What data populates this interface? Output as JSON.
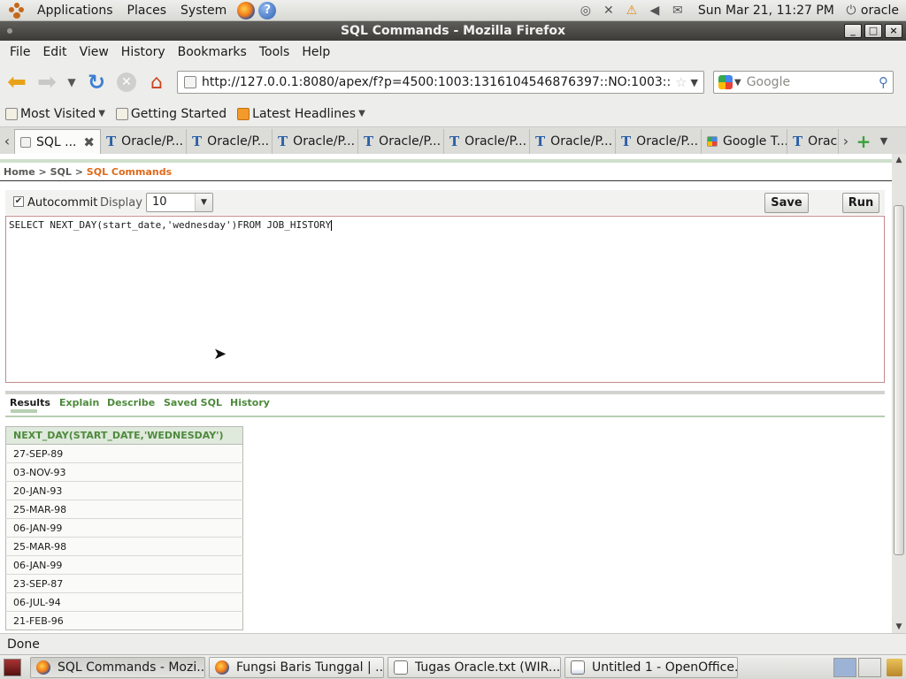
{
  "top_panel": {
    "menus": [
      "Applications",
      "Places",
      "System"
    ],
    "clock": "Sun Mar 21, 11:27 PM",
    "user": "oracle"
  },
  "window": {
    "title": "SQL Commands - Mozilla Firefox"
  },
  "menubar": [
    "File",
    "Edit",
    "View",
    "History",
    "Bookmarks",
    "Tools",
    "Help"
  ],
  "navbar": {
    "url": "http://127.0.0.1:8080/apex/f?p=4500:1003:1316104546876397::NO:1003::",
    "search_placeholder": "Google"
  },
  "bookmarks": [
    "Most Visited",
    "Getting Started",
    "Latest Headlines"
  ],
  "tabs": [
    {
      "label": "SQL ...",
      "active": true
    },
    {
      "label": "Oracle/P..."
    },
    {
      "label": "Oracle/P..."
    },
    {
      "label": "Oracle/P..."
    },
    {
      "label": "Oracle/P..."
    },
    {
      "label": "Oracle/P..."
    },
    {
      "label": "Oracle/P..."
    },
    {
      "label": "Oracle/P..."
    },
    {
      "label": "Google T..."
    },
    {
      "label": "Orac"
    }
  ],
  "page": {
    "breadcrumb": {
      "home": "Home",
      "sql": "SQL",
      "current": "SQL Commands",
      "sep": ">"
    },
    "autocommit_label": "Autocommit",
    "display_label": "Display",
    "display_value": "10",
    "save_label": "Save",
    "run_label": "Run",
    "sql_text": "SELECT NEXT_DAY(start_date,'wednesday')FROM JOB_HISTORY",
    "result_tabs": [
      "Results",
      "Explain",
      "Describe",
      "Saved SQL",
      "History"
    ],
    "results": {
      "column": "NEXT_DAY(START_DATE,'WEDNESDAY')",
      "rows": [
        "27-SEP-89",
        "03-NOV-93",
        "20-JAN-93",
        "25-MAR-98",
        "06-JAN-99",
        "25-MAR-98",
        "06-JAN-99",
        "23-SEP-87",
        "06-JUL-94",
        "21-FEB-96"
      ]
    }
  },
  "status": "Done",
  "taskbar": [
    "SQL Commands - Mozi...",
    "Fungsi Baris Tunggal | ...",
    "Tugas Oracle.txt (WIR...",
    "Untitled 1 - OpenOffice..."
  ]
}
